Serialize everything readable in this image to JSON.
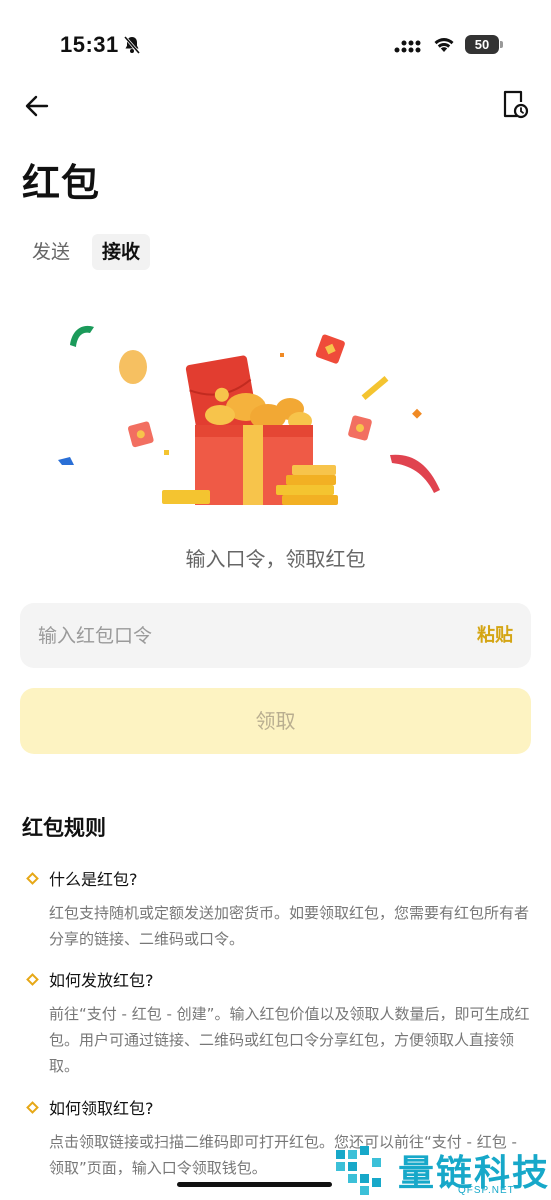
{
  "status": {
    "time": "15:31",
    "battery": "50"
  },
  "header": {
    "title": "红包"
  },
  "tabs": [
    {
      "label": "发送",
      "active": false
    },
    {
      "label": "接收",
      "active": true
    }
  ],
  "receive": {
    "subtitle": "输入口令，领取红包",
    "input_placeholder": "输入红包口令",
    "paste_label": "粘贴",
    "claim_label": "领取"
  },
  "rules": {
    "title": "红包规则",
    "items": [
      {
        "question": "什么是红包?",
        "answer": "红包支持随机或定额发送加密货币。如要领取红包，您需要有红包所有者分享的链接、二维码或口令。"
      },
      {
        "question": "如何发放红包?",
        "answer": "前往“支付 - 红包 - 创建”。输入红包价值以及领取人数量后，即可生成红包。用户可通过链接、二维码或红包口令分享红包，方便领取人直接领取。"
      },
      {
        "question": "如何领取红包?",
        "answer": "点击领取链接或扫描二维码即可打开红包。您还可以前往“支付 - 红包 - 领取”页面，输入口令领取钱包。"
      }
    ]
  },
  "watermark": {
    "text": "量链科技",
    "sub": "QFSP.NET"
  },
  "colors": {
    "accent": "#d4a514",
    "claim_bg": "#fdf3c2",
    "red_envelope": "#ef4b3a"
  }
}
